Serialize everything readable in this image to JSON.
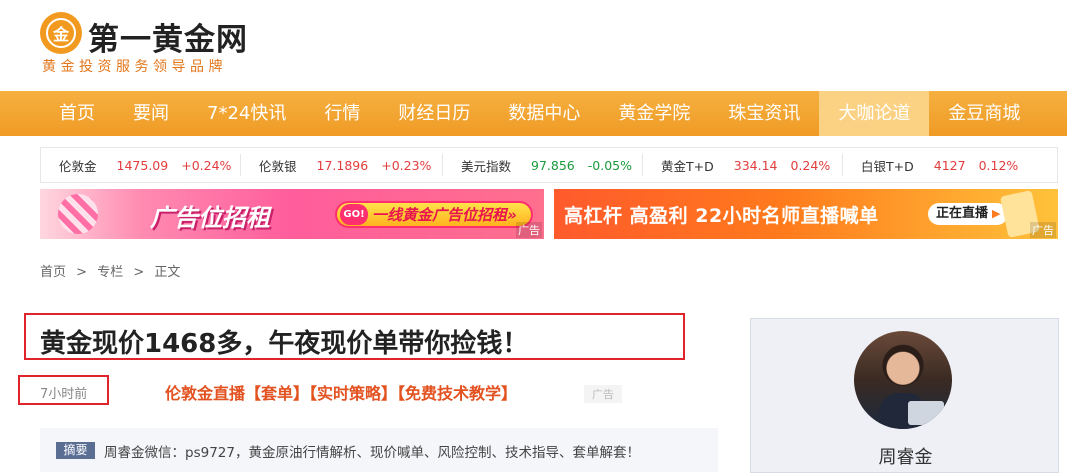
{
  "header": {
    "logo_char": "金",
    "site_name": "第一黄金网",
    "slogan": "黄金投资服务领导品牌"
  },
  "nav": {
    "items": [
      {
        "label": "首页",
        "active": false
      },
      {
        "label": "要闻",
        "active": false
      },
      {
        "label": "7*24快讯",
        "active": false
      },
      {
        "label": "行情",
        "active": false
      },
      {
        "label": "财经日历",
        "active": false
      },
      {
        "label": "数据中心",
        "active": false
      },
      {
        "label": "黄金学院",
        "active": false
      },
      {
        "label": "珠宝资讯",
        "active": false
      },
      {
        "label": "大咖论道",
        "active": true
      },
      {
        "label": "金豆商城",
        "active": false
      }
    ]
  },
  "ticker": [
    {
      "name": "伦敦金",
      "price": "1475.09",
      "change": "+0.24%",
      "direction": "up"
    },
    {
      "name": "伦敦银",
      "price": "17.1896",
      "change": "+0.23%",
      "direction": "up"
    },
    {
      "name": "美元指数",
      "price": "97.856",
      "change": "-0.05%",
      "direction": "down"
    },
    {
      "name": "黄金T+D",
      "price": "334.14",
      "change": "0.24%",
      "direction": "up"
    },
    {
      "name": "白银T+D",
      "price": "4127",
      "change": "0.12%",
      "direction": "up"
    }
  ],
  "banners": {
    "left": {
      "title": "广告位招租",
      "go": "GO!",
      "pill_text": "一线黄金广告位招租»",
      "ad_label": "广告"
    },
    "right": {
      "text": "高杠杆  高盈利  22小时名师直播喊单",
      "live": "正在直播",
      "ad_label": "广告"
    }
  },
  "breadcrumb": [
    "首页",
    ">",
    "专栏",
    ">",
    "正文"
  ],
  "article": {
    "title": "黄金现价1468多，午夜现价单带你捡钱！",
    "time": "7小时前",
    "promo": "伦敦金直播【套单】【实时策略】【免费技术教学】",
    "promo_ad": "广告",
    "summary_tag": "摘要",
    "summary": "周睿金微信：ps9727，黄金原油行情解析、现价喊单、风险控制、技术指导、套单解套！"
  },
  "author": {
    "name": "周睿金"
  },
  "colors": {
    "nav": "#f2a531",
    "up": "#e23d3d",
    "down": "#1a9b3c",
    "highlight_box": "#e0242b"
  }
}
